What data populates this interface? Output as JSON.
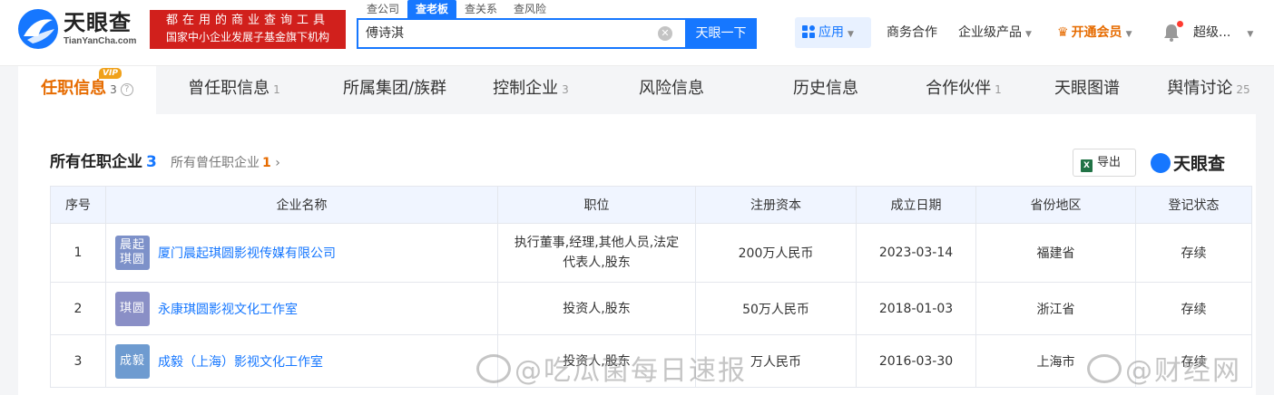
{
  "header": {
    "logo_name": "天眼查",
    "logo_sub": "TianYanCha.com",
    "slogan_line1": "都在用的商业查询工具",
    "slogan_line2": "国家中小企业发展子基金旗下机构",
    "search_tabs": [
      "查公司",
      "查老板",
      "查关系",
      "查风险"
    ],
    "search_value": "傅诗淇",
    "search_button": "天眼一下",
    "apps_label": "应用",
    "nav": {
      "business": "商务合作",
      "enterprise": "企业级产品",
      "vip": "开通会员",
      "user": "超级..."
    }
  },
  "tabs": [
    {
      "label": "任职信息",
      "count": "3",
      "badge": "VIP"
    },
    {
      "label": "曾任职信息",
      "count": "1"
    },
    {
      "label": "所属集团/族群",
      "count": ""
    },
    {
      "label": "控制企业",
      "count": "3"
    },
    {
      "label": "风险信息",
      "count": ""
    },
    {
      "label": "历史信息",
      "count": ""
    },
    {
      "label": "合作伙伴",
      "count": "1"
    },
    {
      "label": "天眼图谱",
      "count": ""
    },
    {
      "label": "舆情讨论",
      "count": "25"
    }
  ],
  "section": {
    "title": "所有任职企业",
    "count": "3",
    "sub_label": "所有曾任职企业",
    "sub_count": "1",
    "export_label": "导出",
    "brand": "天眼查"
  },
  "table": {
    "headers": [
      "序号",
      "企业名称",
      "职位",
      "注册资本",
      "成立日期",
      "省份地区",
      "登记状态"
    ],
    "rows": [
      {
        "index": "1",
        "logo": "晨起琪圆",
        "name": "厦门晨起琪圆影视传媒有限公司",
        "position": "执行董事,经理,其他人员,法定代表人,股东",
        "capital": "200万人民币",
        "date": "2023-03-14",
        "region": "福建省",
        "status": "存续"
      },
      {
        "index": "2",
        "logo": "琪圆",
        "name": "永康琪圆影视文化工作室",
        "position": "投资人,股东",
        "capital": "50万人民币",
        "date": "2018-01-03",
        "region": "浙江省",
        "status": "存续"
      },
      {
        "index": "3",
        "logo": "成毅",
        "name": "成毅（上海）影视文化工作室",
        "position": "投资人,股东",
        "capital": "万人民币",
        "date": "2016-03-30",
        "region": "上海市",
        "status": "存续"
      }
    ]
  },
  "watermarks": [
    "@吃瓜菌每日速报",
    "@财经网"
  ],
  "colors": {
    "primary": "#1677ff",
    "accent": "#e66b00",
    "ok": "#2aa44f",
    "slogan_bg": "#d1201c"
  }
}
